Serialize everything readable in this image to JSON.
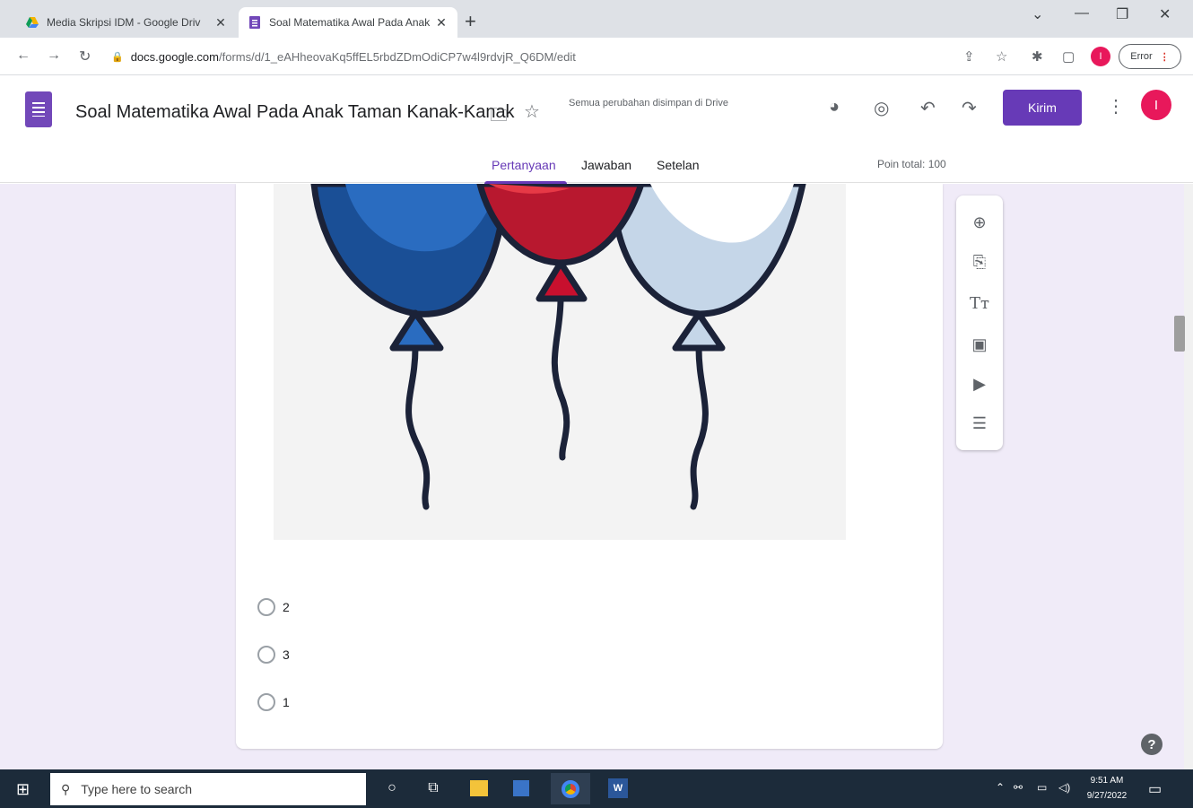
{
  "browser": {
    "tabs": [
      {
        "title": "Media Skripsi IDM - Google Driv"
      },
      {
        "title": "Soal Matematika Awal Pada Anak"
      }
    ],
    "new_tab": "+",
    "url_host": "docs.google.com",
    "url_path": "/forms/d/1_eAHheovaKq5ffEL5rbdZDmOdiCP7w4l9rdvjR_Q6DM/edit",
    "error_label": "Error",
    "profile_initial": "I"
  },
  "form": {
    "title": "Soal Matematika Awal Pada Anak Taman Kanak-Kanak",
    "save_status": "Semua perubahan disimpan di Drive",
    "send_label": "Kirim",
    "tabs": [
      "Pertanyaan",
      "Jawaban",
      "Setelan"
    ],
    "points_total": "Poin total: 100",
    "options": [
      "2",
      "3",
      "1"
    ]
  },
  "toolbar_tools": [
    "add-question",
    "import-questions",
    "add-title",
    "add-image",
    "add-video",
    "add-section"
  ],
  "taskbar": {
    "search_placeholder": "Type here to search",
    "time": "9:51 AM",
    "date": "9/27/2022"
  },
  "colors": {
    "accent": "#673ab7",
    "canvas": "#f0ebf8",
    "balloon_blue": "#1e5fae",
    "balloon_red": "#c8102e",
    "balloon_light": "#c5d6e8",
    "outline": "#1b2238"
  }
}
